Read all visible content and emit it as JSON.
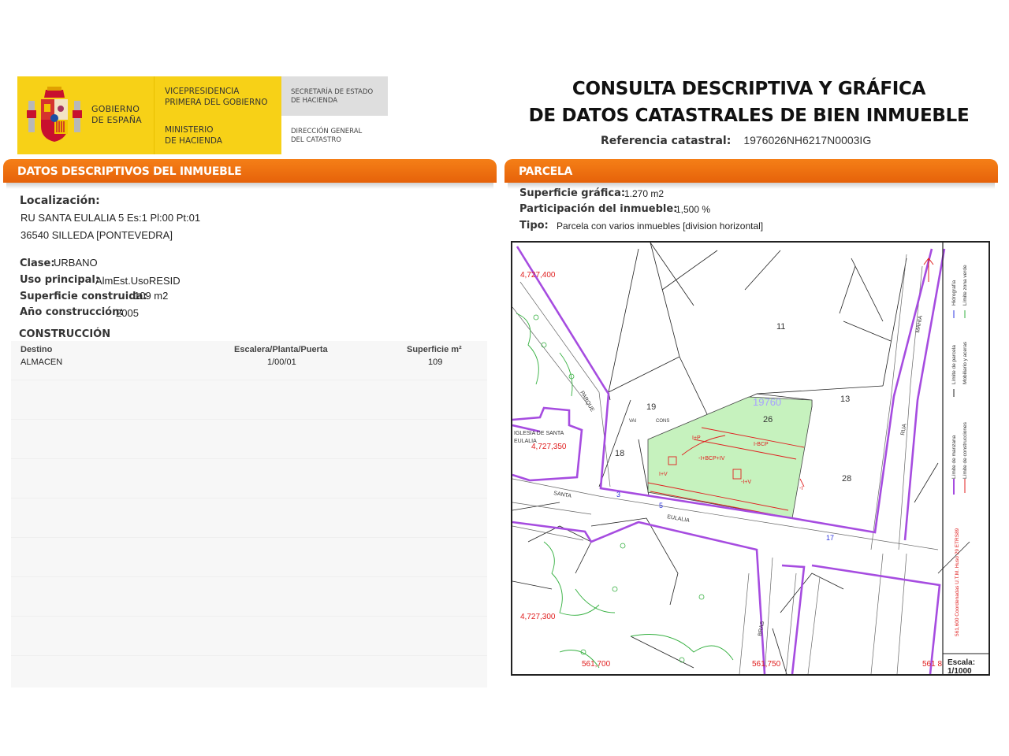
{
  "header": {
    "gov_line1": "GOBIERNO",
    "gov_line2": "DE ESPAÑA",
    "vice_line1": "VICEPRESIDENCIA",
    "vice_line2": "PRIMERA DEL GOBIERNO",
    "min_line1": "MINISTERIO",
    "min_line2": "DE HACIENDA",
    "sec_line1": "SECRETARÍA DE ESTADO",
    "sec_line2": "DE HACIENDA",
    "dir_line1": "DIRECCIÓN GENERAL",
    "dir_line2": "DEL CATASTRO",
    "title_line1": "CONSULTA DESCRIPTIVA Y GRÁFICA",
    "title_line2": "DE DATOS CATASTRALES DE BIEN INMUEBLE",
    "ref_label": "Referencia catastral:",
    "ref_value": "1976026NH6217N0003IG"
  },
  "left": {
    "heading": "DATOS DESCRIPTIVOS DEL INMUEBLE",
    "loc_label": "Localización:",
    "loc_line1": "RU SANTA EULALIA 5 Es:1 Pl:00 Pt:01",
    "loc_line2": "36540 SILLEDA [PONTEVEDRA]",
    "clase_label": "Clase:",
    "clase_value": "URBANO",
    "uso_label": "Uso principal:",
    "uso_value": "AlmEst.UsoRESID",
    "sup_label": "Superficie construida:",
    "sup_value": "109 m2",
    "anio_label": "Año construcción:",
    "anio_value": "2005",
    "construccion_heading": "CONSTRUCCIÓN",
    "table": {
      "headers": [
        "Destino",
        "Escalera/Planta/Puerta",
        "Superficie m²"
      ],
      "rows": [
        [
          "ALMACEN",
          "1/00/01",
          "109"
        ]
      ]
    }
  },
  "right": {
    "heading": "PARCELA",
    "supgraf_label": "Superficie gráfica:",
    "supgraf_value": "1.270 m2",
    "part_label": "Participación del inmueble:",
    "part_value": "1,500 %",
    "tipo_label": "Tipo:",
    "tipo_value": "Parcela con varios inmuebles [division horizontal]"
  },
  "map": {
    "coord_y1": "4,727,400",
    "coord_y2": "4,727,350",
    "coord_y3": "4,727,300",
    "coord_x1": "561,700",
    "coord_x2": "561,750",
    "coord_x3": "561 8",
    "parcel_11": "11",
    "parcel_13": "13",
    "parcel_19": "19",
    "parcel_18": "18",
    "parcel_26": "26",
    "parcel_28": "28",
    "parcel_ref": "19760",
    "church": "IGLESIA DE SANTA",
    "church2": "EULALIA",
    "street_santa": "SANTA",
    "street_eulalia": "EULALIA",
    "street_parque": "PARQUE",
    "street_bras": "BRAS",
    "street_mahia": "MAHIA",
    "street_rua": "RUA",
    "legend_1": "Límite de manzana",
    "legend_2": "Límite de parcela",
    "legend_3": "Hidrografía",
    "legend_4": "Límite de construcciones",
    "legend_5": "Mobiliario y aceras",
    "legend_6": "Límite zona verde",
    "legend_coords": "561,600 Coordenadas U.T.M. Huso 29 ETRS89",
    "scale_label": "Escala:",
    "scale_value": "1/1000",
    "con_1": "VAI",
    "con_2": "CONS",
    "con_3": "I+P",
    "con_4": "-I+BCP+IV",
    "con_5": "I+V",
    "con_6": "-I+V",
    "con_7": "-I",
    "con_8": "I-BCP",
    "house_num_3": "3",
    "house_num_5": "5",
    "house_num_17": "17"
  }
}
